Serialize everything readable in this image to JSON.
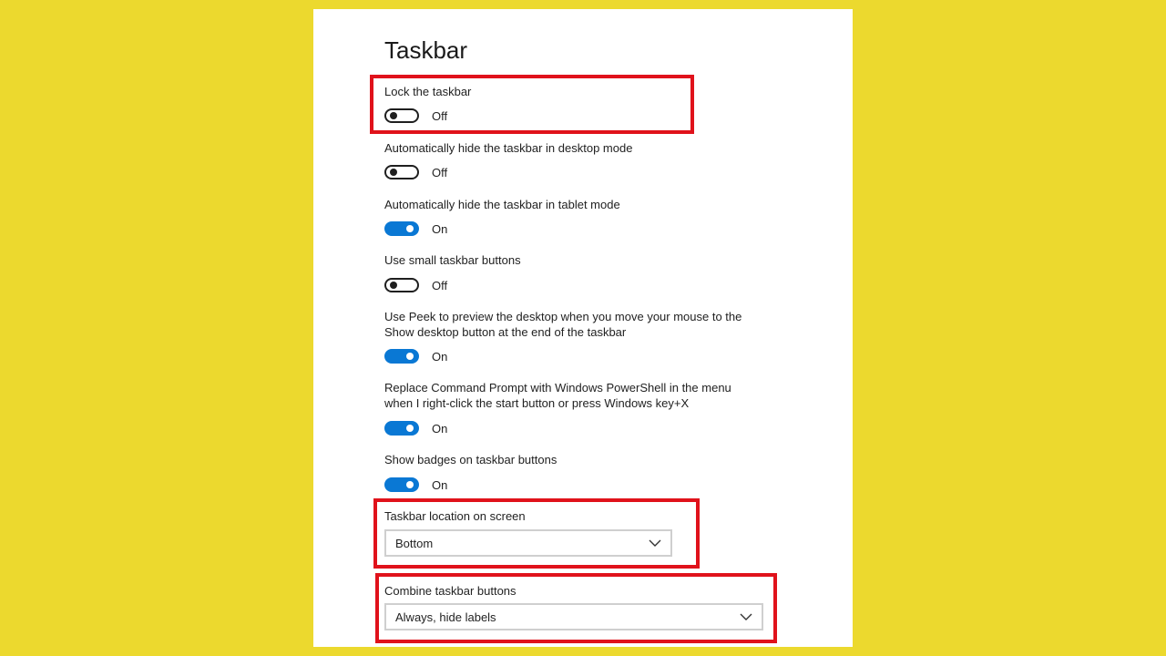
{
  "page": {
    "title": "Taskbar",
    "accent_color": "#0a78d4",
    "highlight_color": "#e0121b"
  },
  "settings": [
    {
      "label": "Lock the taskbar",
      "state": "Off"
    },
    {
      "label": "Automatically hide the taskbar in desktop mode",
      "state": "Off"
    },
    {
      "label": "Automatically hide the taskbar in tablet mode",
      "state": "On"
    },
    {
      "label": "Use small taskbar buttons",
      "state": "Off"
    },
    {
      "label": "Use Peek to preview the desktop when you move your mouse to the\nShow desktop button at the end of the taskbar",
      "state": "On"
    },
    {
      "label": "Replace Command Prompt with Windows PowerShell in the menu\nwhen I right-click the start button or press Windows key+X",
      "state": "On"
    },
    {
      "label": "Show badges on taskbar buttons",
      "state": "On"
    }
  ],
  "dropdowns": [
    {
      "label": "Taskbar location on screen",
      "value": "Bottom",
      "icon": "chevron-down-icon"
    },
    {
      "label": "Combine taskbar buttons",
      "value": "Always, hide labels",
      "icon": "chevron-down-icon"
    }
  ]
}
